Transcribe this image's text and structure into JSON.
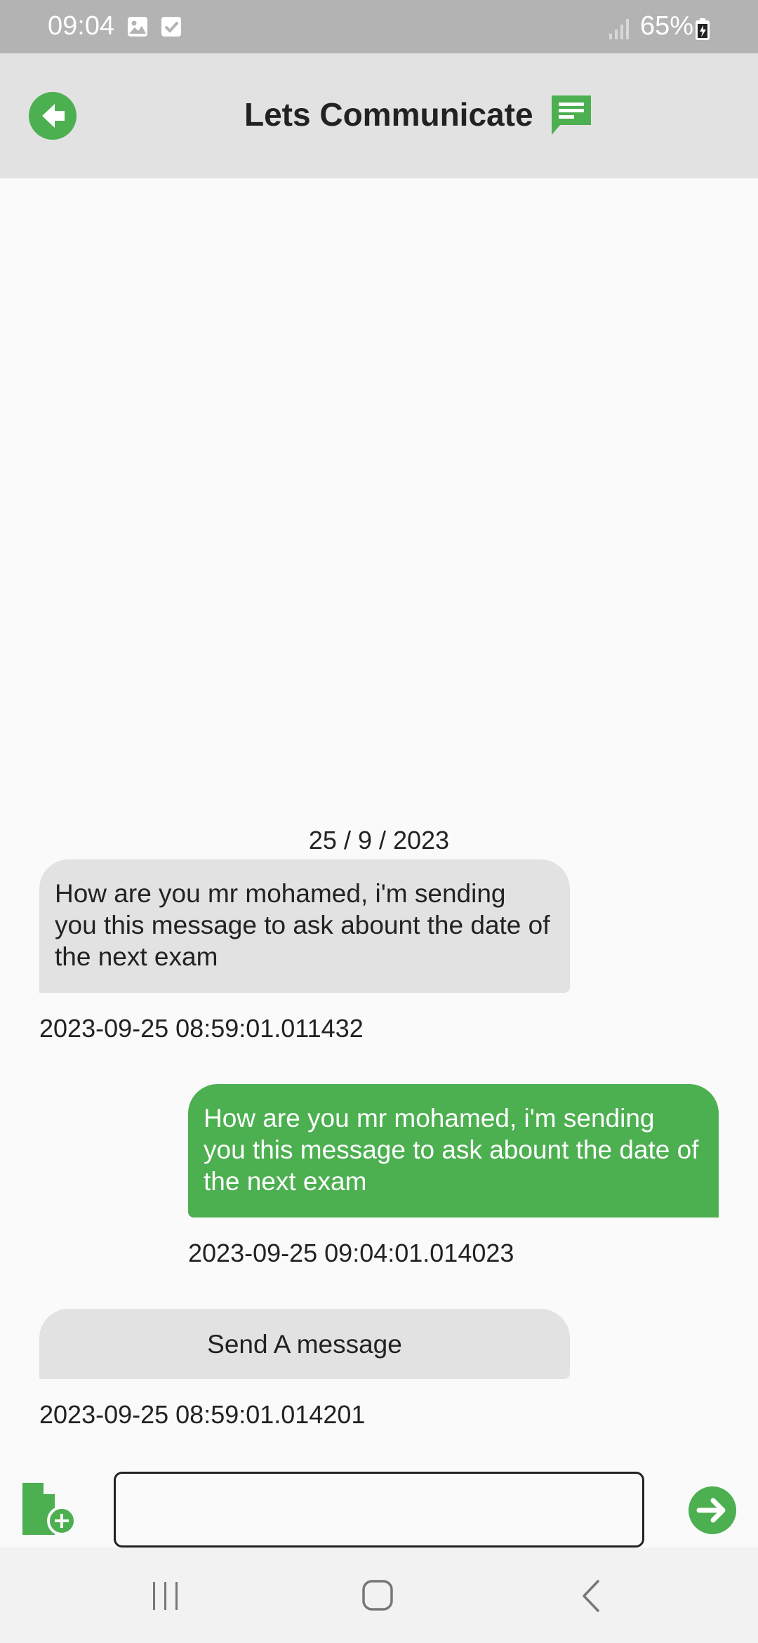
{
  "status_bar": {
    "time": "09:04",
    "battery_percent": "65%",
    "icons": [
      "gallery-icon",
      "checkbox-icon",
      "signal-icon",
      "battery-icon"
    ]
  },
  "app_bar": {
    "title": "Lets Communicate",
    "back_icon": "back-arrow-icon",
    "title_icon": "chat-icon",
    "accent_color": "#4caf50",
    "background_color": "#e2e2e2"
  },
  "chat": {
    "date": "25 / 9 / 2023",
    "messages": [
      {
        "direction": "incoming",
        "text": "How are you mr mohamed, i'm sending you this message to ask abount the date of  the next exam",
        "timestamp": "2023-09-25 08:59:01.011432",
        "bubble_color": "#e2e2e2"
      },
      {
        "direction": "outgoing",
        "text": "How are you mr mohamed, i'm sending you this message to ask abount the date of  the next exam",
        "timestamp": "2023-09-25 09:04:01.014023",
        "bubble_color": "#4caf50"
      },
      {
        "direction": "incoming",
        "text": "Send A message",
        "timestamp": "2023-09-25 08:59:01.014201",
        "bubble_color": "#e2e2e2"
      }
    ]
  },
  "composer": {
    "attach_icon": "file-add-icon",
    "input_value": "",
    "send_icon": "send-arrow-icon"
  },
  "nav_bar": {
    "items": [
      "recent-apps-icon",
      "home-icon",
      "back-icon"
    ]
  }
}
